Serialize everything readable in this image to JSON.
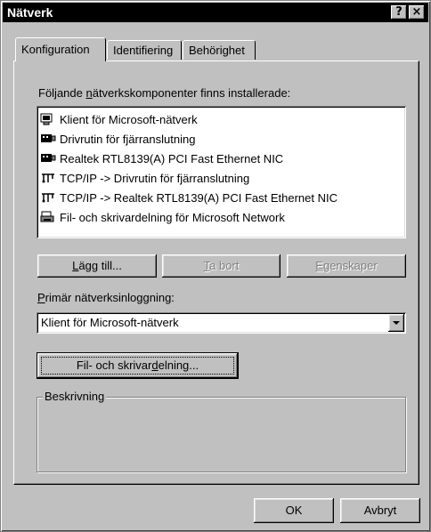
{
  "window": {
    "title": "Nätverk",
    "help_button": "?",
    "close_button": "×"
  },
  "tabs": [
    {
      "label": "Konfiguration",
      "active": true
    },
    {
      "label": "Identifiering",
      "active": false
    },
    {
      "label": "Behörighet",
      "active": false
    }
  ],
  "components": {
    "label_pre": "Följande ",
    "label_accel": "n",
    "label_post": "ätverkskomponenter finns installerade:",
    "items": [
      {
        "label": "Klient för Microsoft-nätverk",
        "icon": "network-client-icon"
      },
      {
        "label": "Drivrutin för fjärranslutning",
        "icon": "network-adapter-icon"
      },
      {
        "label": "Realtek RTL8139(A) PCI Fast Ethernet NIC",
        "icon": "network-adapter-icon"
      },
      {
        "label": "TCP/IP -> Drivrutin för fjärranslutning",
        "icon": "protocol-icon"
      },
      {
        "label": "TCP/IP -> Realtek RTL8139(A) PCI Fast Ethernet NIC",
        "icon": "protocol-icon"
      },
      {
        "label": "Fil- och skrivardelning för Microsoft Network",
        "icon": "service-icon"
      }
    ]
  },
  "buttons": {
    "add": {
      "accel": "L",
      "rest": "ägg till..."
    },
    "remove": {
      "accel": "T",
      "rest": "a bort"
    },
    "properties": {
      "accel": "E",
      "rest": "genskaper"
    }
  },
  "primary_logon": {
    "label_accel": "P",
    "label_rest": "rimär nätverksinloggning:",
    "value": "Klient för Microsoft-nätverk"
  },
  "file_print_button": {
    "pre": "Fil- och skrivar",
    "accel": "d",
    "post": "elning..."
  },
  "description": {
    "legend": "Beskrivning"
  },
  "footer": {
    "ok": "OK",
    "cancel": "Avbryt"
  }
}
